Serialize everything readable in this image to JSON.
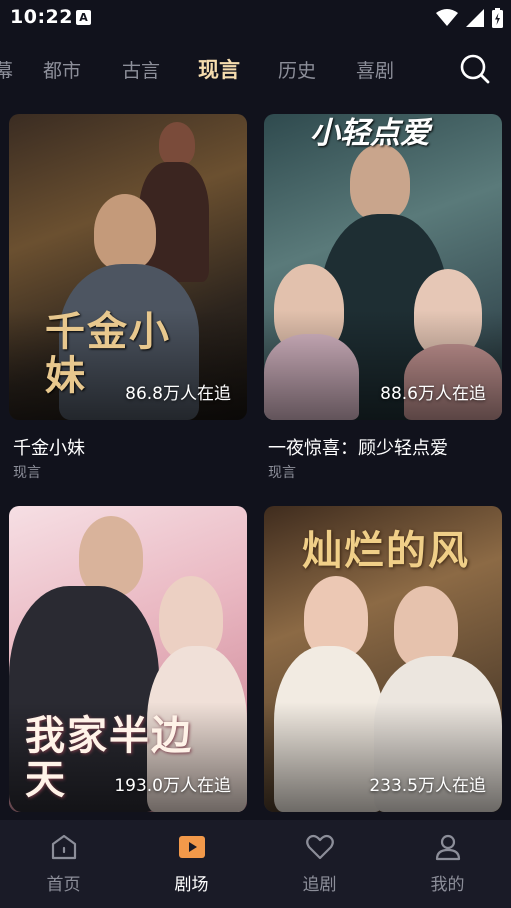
{
  "status_bar": {
    "time": "10:22",
    "notification_icon": "a-letter-icon",
    "icons": [
      "wifi-icon",
      "signal-icon",
      "battery-icon"
    ]
  },
  "tabs": [
    {
      "label": "幕",
      "active": false
    },
    {
      "label": "都市",
      "active": false
    },
    {
      "label": "古言",
      "active": false
    },
    {
      "label": "现言",
      "active": true
    },
    {
      "label": "历史",
      "active": false
    },
    {
      "label": "喜剧",
      "active": false
    }
  ],
  "search_icon": "search-icon",
  "cards": [
    {
      "title": "千金小妹",
      "genre": "现言",
      "followers": "86.8万人在追",
      "poster_title": "千金小妹"
    },
    {
      "title": "一夜惊喜：顾少轻点爱",
      "genre": "现言",
      "followers": "88.6万人在追",
      "poster_title": "小轻点爱"
    },
    {
      "title": "",
      "genre": "",
      "followers": "193.0万人在追",
      "poster_title": "我家半边天"
    },
    {
      "title": "",
      "genre": "",
      "followers": "233.5万人在追",
      "poster_title": "灿烂的风"
    }
  ],
  "bottom_nav": [
    {
      "label": "首页",
      "icon": "home-icon",
      "active": false
    },
    {
      "label": "剧场",
      "icon": "play-icon",
      "active": true
    },
    {
      "label": "追剧",
      "icon": "heart-icon",
      "active": false
    },
    {
      "label": "我的",
      "icon": "user-icon",
      "active": false
    }
  ],
  "colors": {
    "background": "#11121c",
    "active_tab": "#f5dcae",
    "inactive_text": "#8c8e99",
    "accent": "#f2994a",
    "nav_background": "#1a1b27"
  }
}
